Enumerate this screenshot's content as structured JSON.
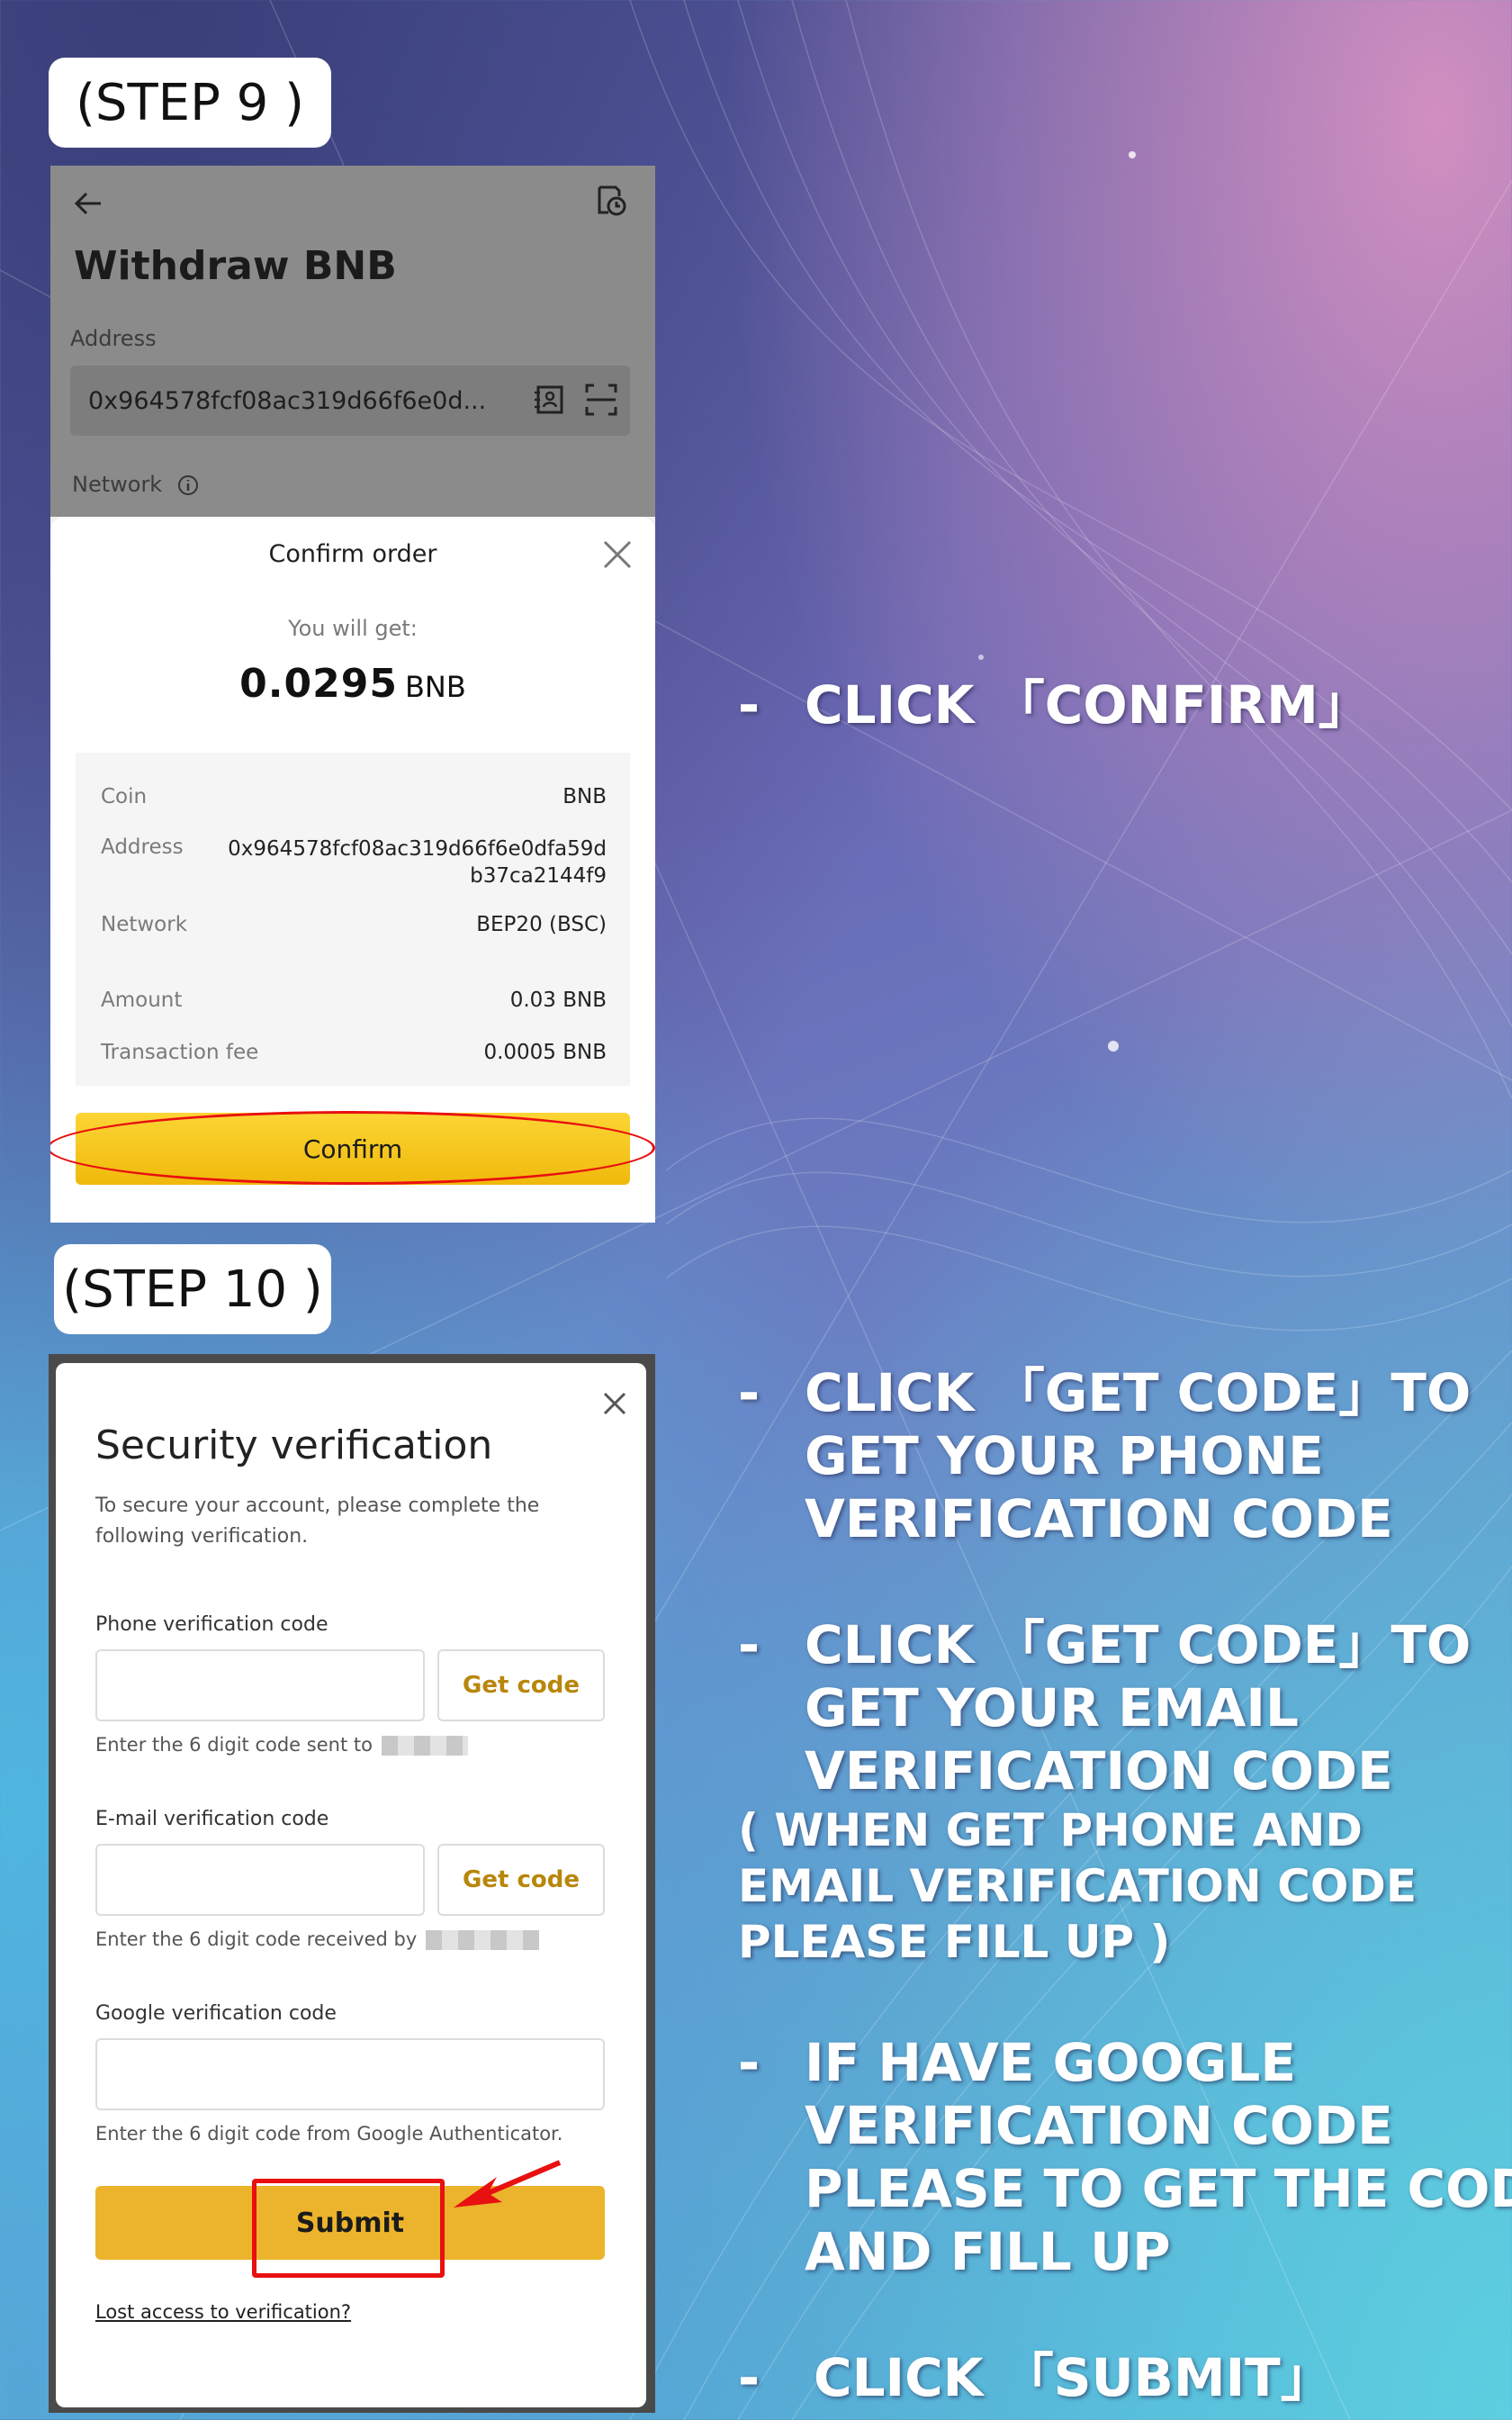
{
  "steps": {
    "step9_label": "(STEP 9 )",
    "step10_label": "(STEP 10 )"
  },
  "withdraw_screen": {
    "title": "Withdraw BNB",
    "address_label": "Address",
    "address_value": "0x964578fcf08ac319d66f6e0d...",
    "network_label": "Network"
  },
  "confirm_order": {
    "title": "Confirm order",
    "you_will_get": "You will get:",
    "amount": "0.0295",
    "amount_unit": "BNB",
    "rows": {
      "coin": {
        "key": "Coin",
        "value": "BNB"
      },
      "address": {
        "key": "Address",
        "value": "0x964578fcf08ac319d66f6e0dfa59db37ca2144f9"
      },
      "network": {
        "key": "Network",
        "value": "BEP20 (BSC)"
      },
      "amount": {
        "key": "Amount",
        "value": "0.03 BNB"
      },
      "fee": {
        "key": "Transaction fee",
        "value": "0.0005 BNB"
      }
    },
    "confirm_button": "Confirm"
  },
  "security_verification": {
    "title": "Security verification",
    "description": "To secure your account, please complete the following verification.",
    "phone_label": "Phone verification code",
    "phone_get_code": "Get code",
    "phone_hint": "Enter the 6 digit code sent to",
    "email_label": "E-mail verification code",
    "email_get_code": "Get code",
    "email_hint": "Enter the 6 digit code received by",
    "google_label": "Google verification code",
    "google_hint": "Enter the 6 digit code from Google Authenticator.",
    "submit_button": "Submit",
    "lost_access_link": "Lost access to verification?"
  },
  "instructions": {
    "dash": "-",
    "click_confirm": "CLICK 「CONFIRM」",
    "phone_code_lines": [
      "CLICK 「GET CODE」TO",
      "GET YOUR PHONE",
      "VERIFICATION CODE"
    ],
    "email_code_lines": [
      "CLICK 「GET CODE」TO",
      "GET YOUR EMAIL",
      "VERIFICATION CODE"
    ],
    "fill_note_lines": [
      "( WHEN GET PHONE AND",
      "EMAIL VERIFICATION CODE",
      "PLEASE FILL UP )"
    ],
    "google_lines": [
      "IF HAVE GOOGLE",
      "VERIFICATION CODE",
      "PLEASE TO GET THE CODE",
      "AND FILL UP"
    ],
    "click_submit": "CLICK 「SUBMIT」"
  },
  "colors": {
    "binance_yellow": "#f0b90b",
    "highlight_red": "#e81010"
  }
}
